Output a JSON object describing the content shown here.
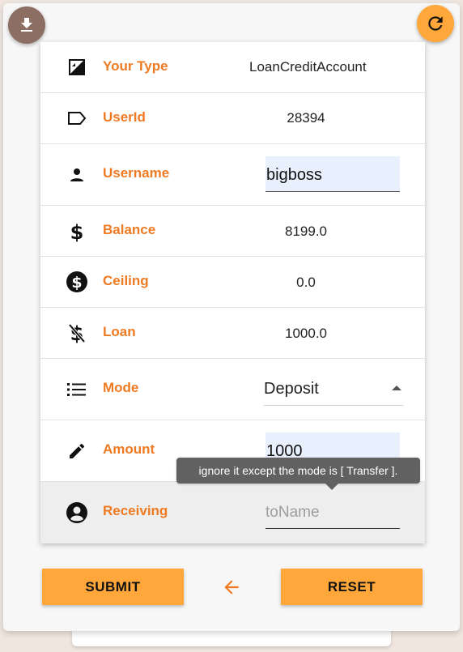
{
  "colors": {
    "accent": "#ef7a22",
    "button": "#ffa73a",
    "download_fab": "#8d6e63",
    "tooltip_bg": "#616161",
    "input_bg": "#e8f0fe"
  },
  "toolbar": {
    "download_icon": "download-icon",
    "refresh_icon": "refresh-icon"
  },
  "fields": {
    "type": {
      "icon": "account-type-icon",
      "label": "Your Type",
      "value": "LoanCreditAccount"
    },
    "userid": {
      "icon": "label-tag-icon",
      "label": "UserId",
      "value": "28394"
    },
    "username": {
      "icon": "person-icon",
      "label": "Username",
      "value": "bigboss"
    },
    "balance": {
      "icon": "dollar-icon",
      "label": "Balance",
      "value": "8199.0"
    },
    "ceiling": {
      "icon": "dollar-circle-icon",
      "label": "Ceiling",
      "value": "0.0"
    },
    "loan": {
      "icon": "dollar-off-icon",
      "label": "Loan",
      "value": "1000.0"
    },
    "mode": {
      "icon": "list-icon",
      "label": "Mode",
      "value": "Deposit"
    },
    "amount": {
      "icon": "pencil-icon",
      "label": "Amount",
      "value": "1000"
    },
    "receiving": {
      "icon": "account-circle-icon",
      "label": "Receiving",
      "placeholder": "toName"
    }
  },
  "tooltip": "ignore it except the mode is [ Transfer ].",
  "buttons": {
    "submit": "SUBMIT",
    "back_icon": "arrow-left-icon",
    "reset": "RESET"
  }
}
